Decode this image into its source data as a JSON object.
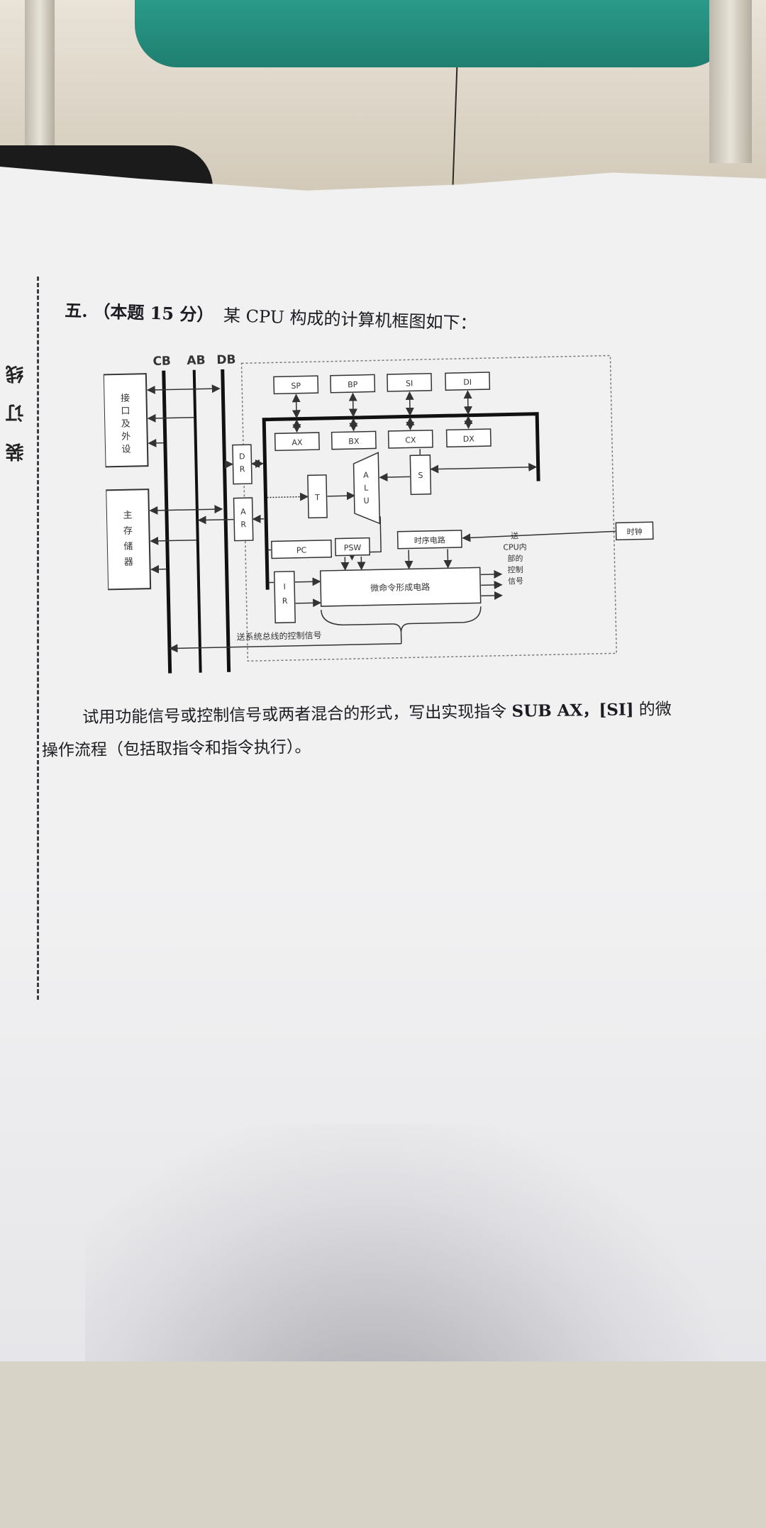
{
  "binding_margin": {
    "label": "装 订 线"
  },
  "question": {
    "number": "五.",
    "score": "（本题 15 分）",
    "intro": "某 CPU 构成的计算机框图如下：",
    "prompt_line1_a": "试用功能信号或控制信号或两者混合的形式，写出实现指令",
    "instruction": "SUB   AX，[SI]",
    "prompt_line1_b": "的微",
    "prompt_line2": "操作流程（包括取指令和指令执行）。"
  },
  "diagram": {
    "buses": {
      "cb": "CB",
      "ab": "AB",
      "db": "DB"
    },
    "io_box": "接口及外设",
    "memory_box": "主存储器",
    "top_registers": [
      "SP",
      "BP",
      "SI",
      "DI"
    ],
    "general_registers": [
      "AX",
      "BX",
      "CX",
      "DX"
    ],
    "dr": "D R",
    "ar": "A R",
    "t": "T",
    "alu": "A L U",
    "s": "S",
    "pc": "PC",
    "psw": "PSW",
    "timing": "时序电路",
    "clock": "时钟",
    "ir": "I R",
    "micro": "微命令形成电路",
    "to_cpu_internal": "送CPU内部的控制信号",
    "to_system_bus": "送系统总线的控制信号"
  }
}
